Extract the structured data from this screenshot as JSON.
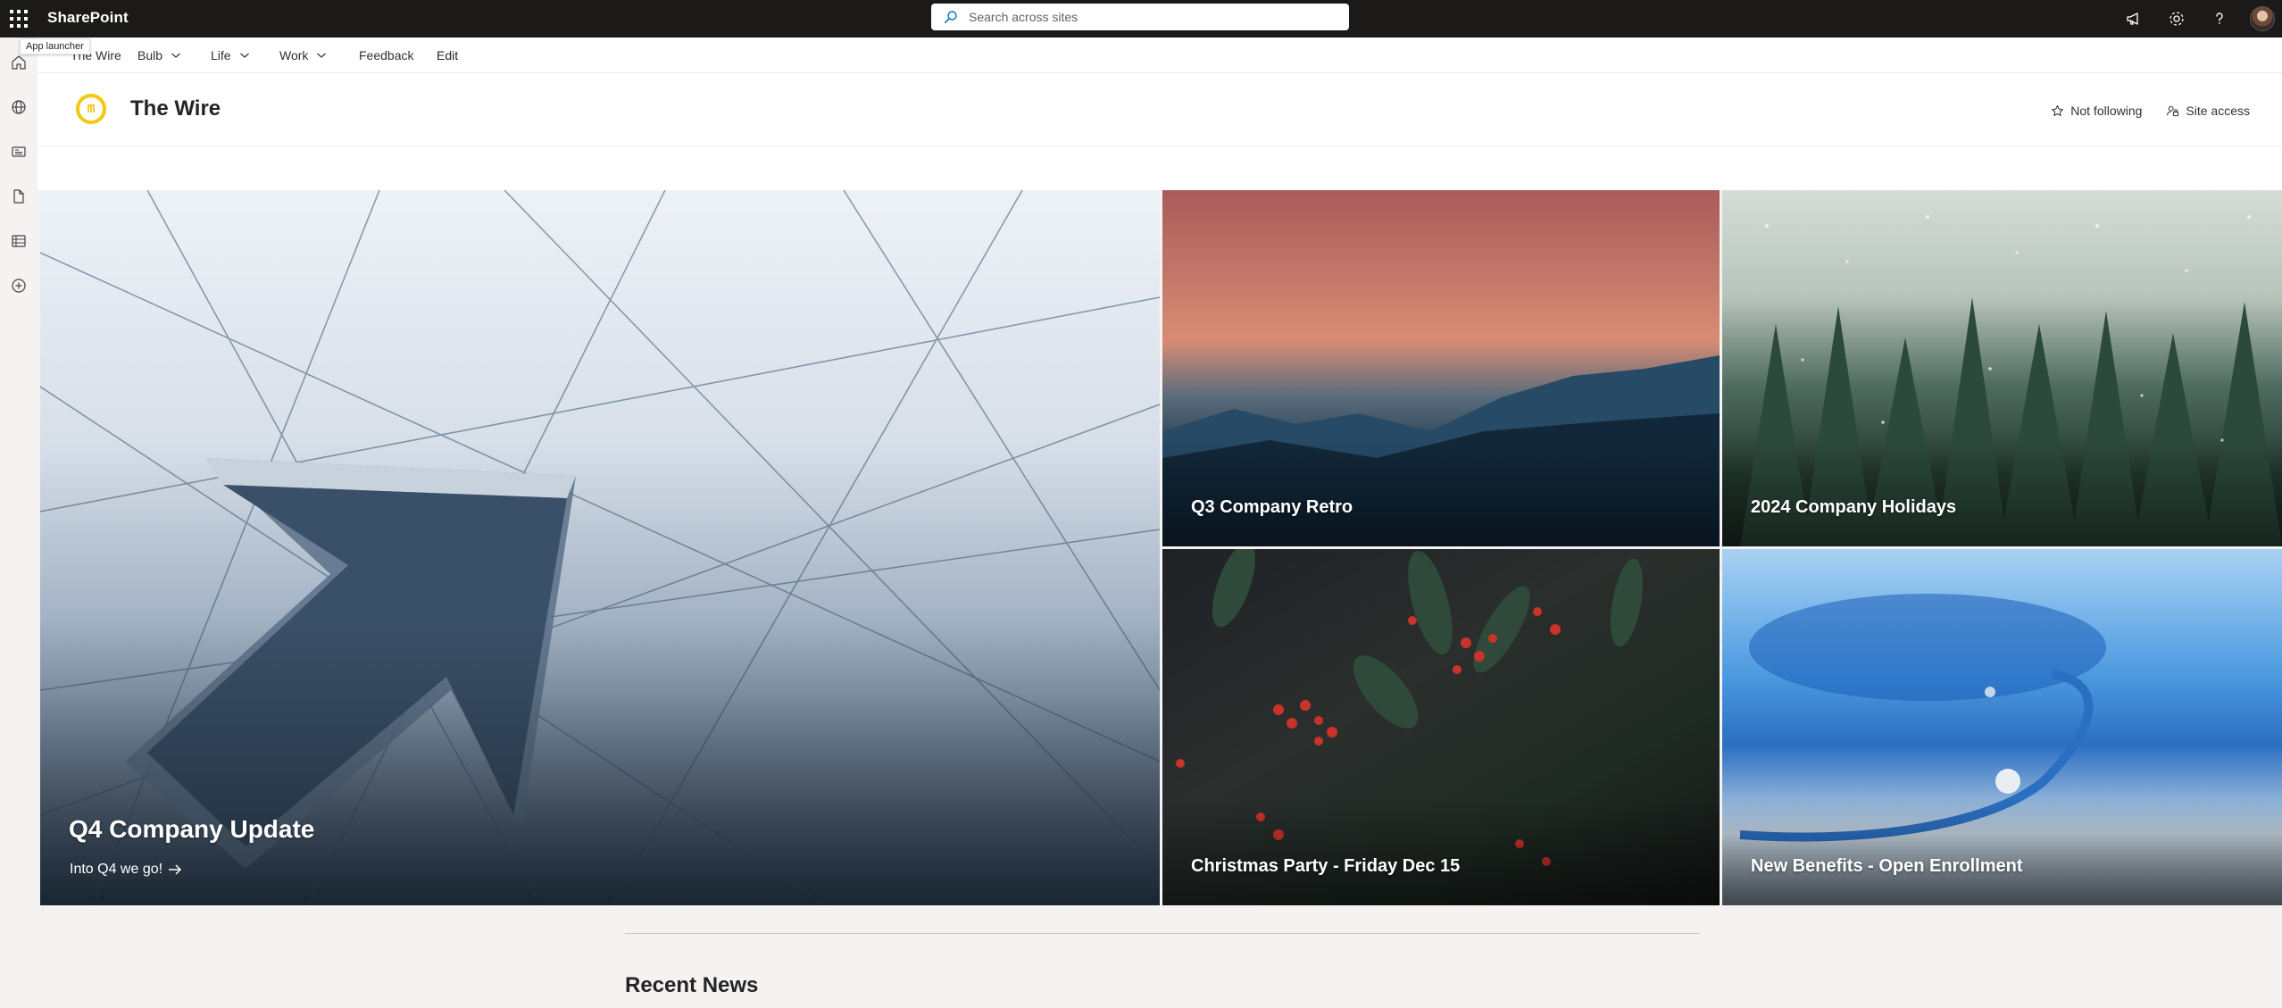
{
  "suite": {
    "brand": "SharePoint",
    "search_placeholder": "Search across sites",
    "tooltip": "App launcher",
    "icons": [
      "megaphone-icon",
      "gear-icon",
      "help-icon",
      "avatar"
    ]
  },
  "appbar": {
    "items": [
      "home-icon",
      "globe-icon",
      "news-icon",
      "file-icon",
      "list-icon",
      "add-icon"
    ]
  },
  "hubnav": {
    "items": [
      {
        "label": "The Wire",
        "dropdown": false
      },
      {
        "label": "Bulb",
        "dropdown": true
      },
      {
        "label": "Life",
        "dropdown": true
      },
      {
        "label": "Work",
        "dropdown": true
      },
      {
        "label": "Feedback",
        "dropdown": false
      },
      {
        "label": "Edit",
        "dropdown": false
      }
    ]
  },
  "site": {
    "title": "The Wire",
    "follow_label": "Not following",
    "access_label": "Site access",
    "logo_color": "#f2c811"
  },
  "hero": {
    "main": {
      "title": "Q4 Company Update",
      "subtitle": "Into Q4 we go!"
    },
    "tiles": [
      {
        "title": "Q3 Company Retro"
      },
      {
        "title": "2024 Company Holidays"
      },
      {
        "title": "Christmas Party - Friday Dec 15"
      },
      {
        "title": "New Benefits - Open Enrollment"
      }
    ]
  },
  "news": {
    "title": "Recent News"
  }
}
